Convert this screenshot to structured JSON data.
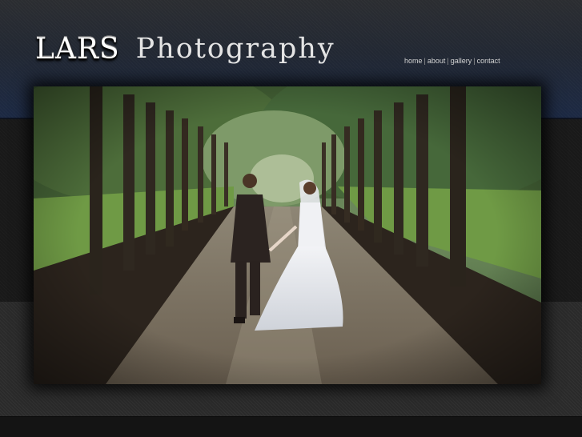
{
  "brand": {
    "name_part1": "LARS",
    "name_part2": "Photography"
  },
  "nav": {
    "items": [
      {
        "label": "home"
      },
      {
        "label": "about"
      },
      {
        "label": "gallery"
      },
      {
        "label": "contact"
      }
    ],
    "separator": "|"
  },
  "hero": {
    "subject": "bride and groom walking down tree-lined dirt road"
  },
  "colors": {
    "header_blue": "#1c2944",
    "page_dark": "#191919",
    "nav_text": "#d4d4d4"
  }
}
